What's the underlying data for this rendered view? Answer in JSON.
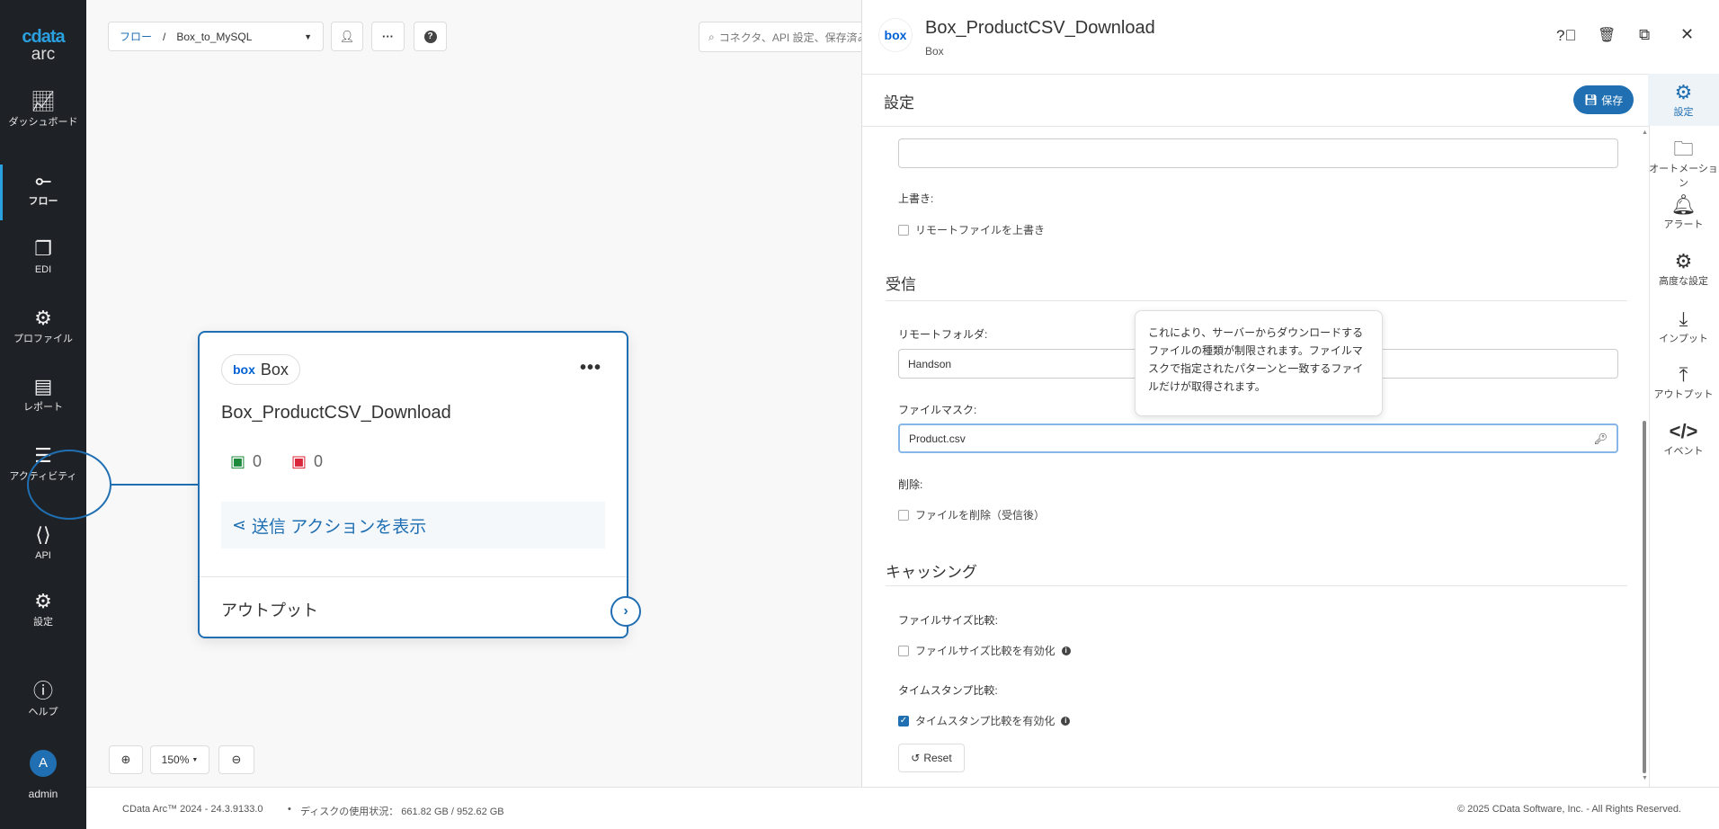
{
  "sidebar": {
    "logo_top": "cdata",
    "logo_bottom": "arc",
    "items": [
      {
        "label": "ダッシュボード",
        "icon": "chart-line-icon"
      },
      {
        "label": "フロー",
        "icon": "flow-icon"
      },
      {
        "label": "EDI",
        "icon": "copy-icon"
      },
      {
        "label": "プロファイル",
        "icon": "gears-icon"
      },
      {
        "label": "レポート",
        "icon": "report-icon"
      },
      {
        "label": "アクティビティ",
        "icon": "activity-icon"
      },
      {
        "label": "API",
        "icon": "api-icon"
      },
      {
        "label": "設定",
        "icon": "gear-icon"
      },
      {
        "label": "ヘルプ",
        "icon": "help-icon"
      }
    ],
    "user": {
      "initial": "A",
      "name": "admin"
    }
  },
  "toolbar": {
    "crumb_root": "フロー",
    "crumb_sep": "/",
    "flow_name": "Box_to_MySQL",
    "search_placeholder": "コネクタ、API 設定、保存済み"
  },
  "node": {
    "badge": "Box",
    "badge_logo": "box",
    "title": "Box_ProductCSV_Download",
    "success_count": "0",
    "error_count": "0",
    "action_label": "送信 アクションを表示",
    "output_label": "アウトプット"
  },
  "zoom": {
    "level": "150%"
  },
  "panel": {
    "logo": "box",
    "title": "Box_ProductCSV_Download",
    "subtitle": "Box",
    "section_title": "設定",
    "save_label": "保存",
    "overwrite_label": "上書き:",
    "overwrite_cb": "リモートファイルを上書き",
    "receive_heading": "受信",
    "remote_folder_label": "リモートフォルダ:",
    "remote_folder_value": "Handson",
    "file_mask_label": "ファイルマスク:",
    "file_mask_value": "Product.csv",
    "delete_label": "削除:",
    "delete_cb": "ファイルを削除（受信後）",
    "caching_heading": "キャッシング",
    "size_label": "ファイルサイズ比較:",
    "size_cb": "ファイルサイズ比較を有効化",
    "ts_label": "タイムスタンプ比較:",
    "ts_cb": "タイムスタンプ比較を有効化",
    "reset_label": "Reset",
    "tooltip": "これにより、サーバーからダウンロードするファイルの種類が制限されます。ファイルマスクで指定されたパターンと一致するファイルだけが取得されます。",
    "tabs": [
      {
        "label": "設定"
      },
      {
        "label": "オートメーション"
      },
      {
        "label": "アラート"
      },
      {
        "label": "高度な設定"
      },
      {
        "label": "インプット"
      },
      {
        "label": "アウトプット"
      },
      {
        "label": "イベント"
      }
    ]
  },
  "footer": {
    "version": "CData Arc™ 2024 - 24.3.9133.0",
    "disk": "ディスクの使用状況： 661.82 GB / 952.62 GB",
    "copyright": "© 2025 CData Software, Inc. - All Rights Reserved."
  },
  "colors": {
    "accent": "#1f6fb2",
    "sidebar": "#1e2226"
  }
}
